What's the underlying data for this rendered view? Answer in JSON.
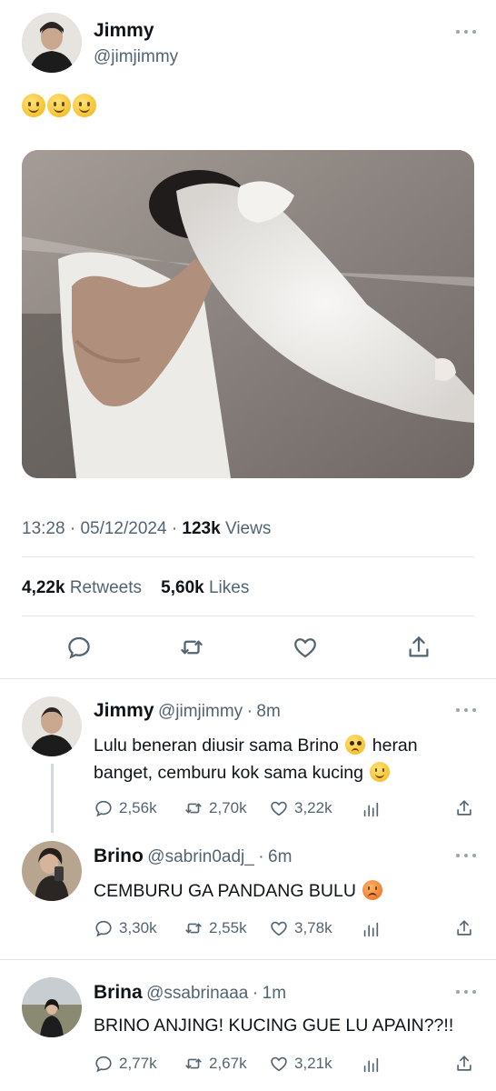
{
  "main_tweet": {
    "author_name": "Jimmy",
    "author_handle": "@jimjimmy",
    "text_emojis": [
      "slightly-smiling-face",
      "slightly-smiling-face",
      "slightly-smiling-face"
    ],
    "time": "13:28",
    "date": "05/12/2024",
    "views_count": "123k",
    "views_label": "Views",
    "retweets_count": "4,22k",
    "retweets_label": "Retweets",
    "likes_count": "5,60k",
    "likes_label": "Likes"
  },
  "replies": [
    {
      "author_name": "Jimmy",
      "author_handle": "@jimjimmy",
      "time": "8m",
      "text_part1": "Lulu beneran diusir sama Brino",
      "emoji1": "pleading-face",
      "text_part2": "heran banget, cemburu kok sama kucing",
      "emoji2": "slightly-smiling-face",
      "replies": "2,56k",
      "retweets": "2,70k",
      "likes": "3,22k"
    },
    {
      "author_name": "Brino",
      "author_handle": "@sabrin0adj_",
      "time": "6m",
      "text_part1": "CEMBURU GA PANDANG BULU",
      "emoji1": "angry-face",
      "replies": "3,30k",
      "retweets": "2,55k",
      "likes": "3,78k"
    },
    {
      "author_name": "Brina",
      "author_handle": "@ssabrinaaa",
      "time": "1m",
      "text_part1": "BRINO ANJING! KUCING GUE LU APAIN??!!",
      "replies": "2,77k",
      "retweets": "2,67k",
      "likes": "3,21k"
    }
  ],
  "separator": "·",
  "colors": {
    "text": "#0f1419",
    "secondary": "#536471",
    "divider": "#e3e6e9",
    "icon": "#536471"
  }
}
